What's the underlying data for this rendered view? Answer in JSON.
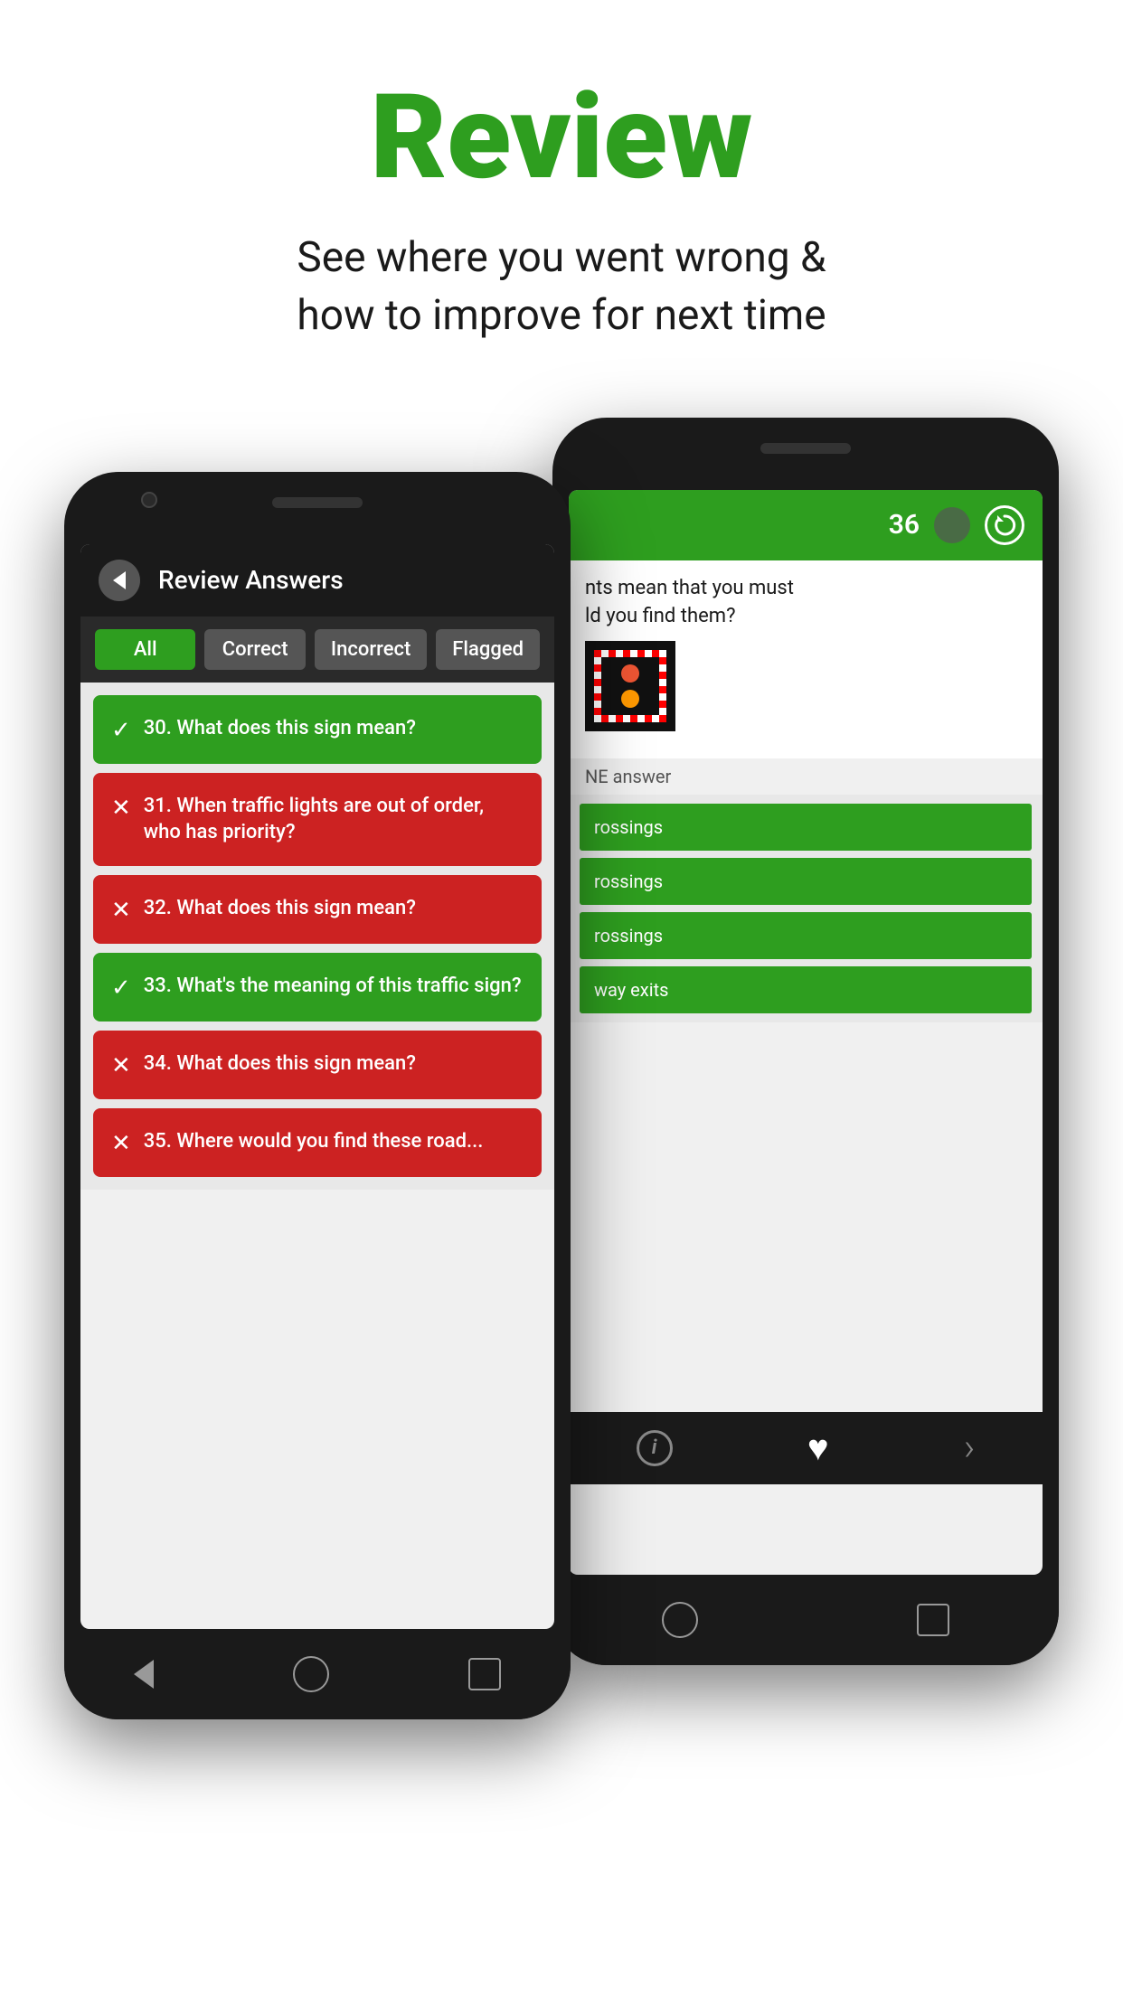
{
  "header": {
    "title": "Review",
    "subtitle_line1": "See where you went wrong &",
    "subtitle_line2": "how to improve for next time"
  },
  "left_phone": {
    "app_header": {
      "title": "Review Answers"
    },
    "filter_tabs": [
      {
        "label": "All",
        "active": true
      },
      {
        "label": "Correct",
        "active": false
      },
      {
        "label": "Incorrect",
        "active": false
      },
      {
        "label": "Flagged",
        "active": false
      }
    ],
    "questions": [
      {
        "number": "30.",
        "text": "What does this sign mean?",
        "correct": true
      },
      {
        "number": "31.",
        "text": "When traffic lights are out of order, who has priority?",
        "correct": false
      },
      {
        "number": "32.",
        "text": "What does this sign mean?",
        "correct": false
      },
      {
        "number": "33.",
        "text": "What's the meaning of this traffic sign?",
        "correct": true
      },
      {
        "number": "34.",
        "text": "What does this sign mean?",
        "correct": false
      },
      {
        "number": "35.",
        "text": "Where would you find these road...",
        "correct": false
      }
    ],
    "nav": {
      "back": "",
      "home": "",
      "square": ""
    }
  },
  "right_phone": {
    "question_number": "36",
    "question_text_line1": "nts mean that you must",
    "question_text_line2": "ld you find them?",
    "answer_instruction": "NE answer",
    "answers": [
      {
        "text": "rossings"
      },
      {
        "text": "rossings"
      },
      {
        "text": "rossings"
      },
      {
        "text": "way exits"
      }
    ],
    "nav": {
      "home": "",
      "square": ""
    }
  },
  "colors": {
    "green": "#2e9e1f",
    "red": "#cc2222",
    "dark": "#1a1a1a",
    "title_green": "#2e9e1f"
  }
}
